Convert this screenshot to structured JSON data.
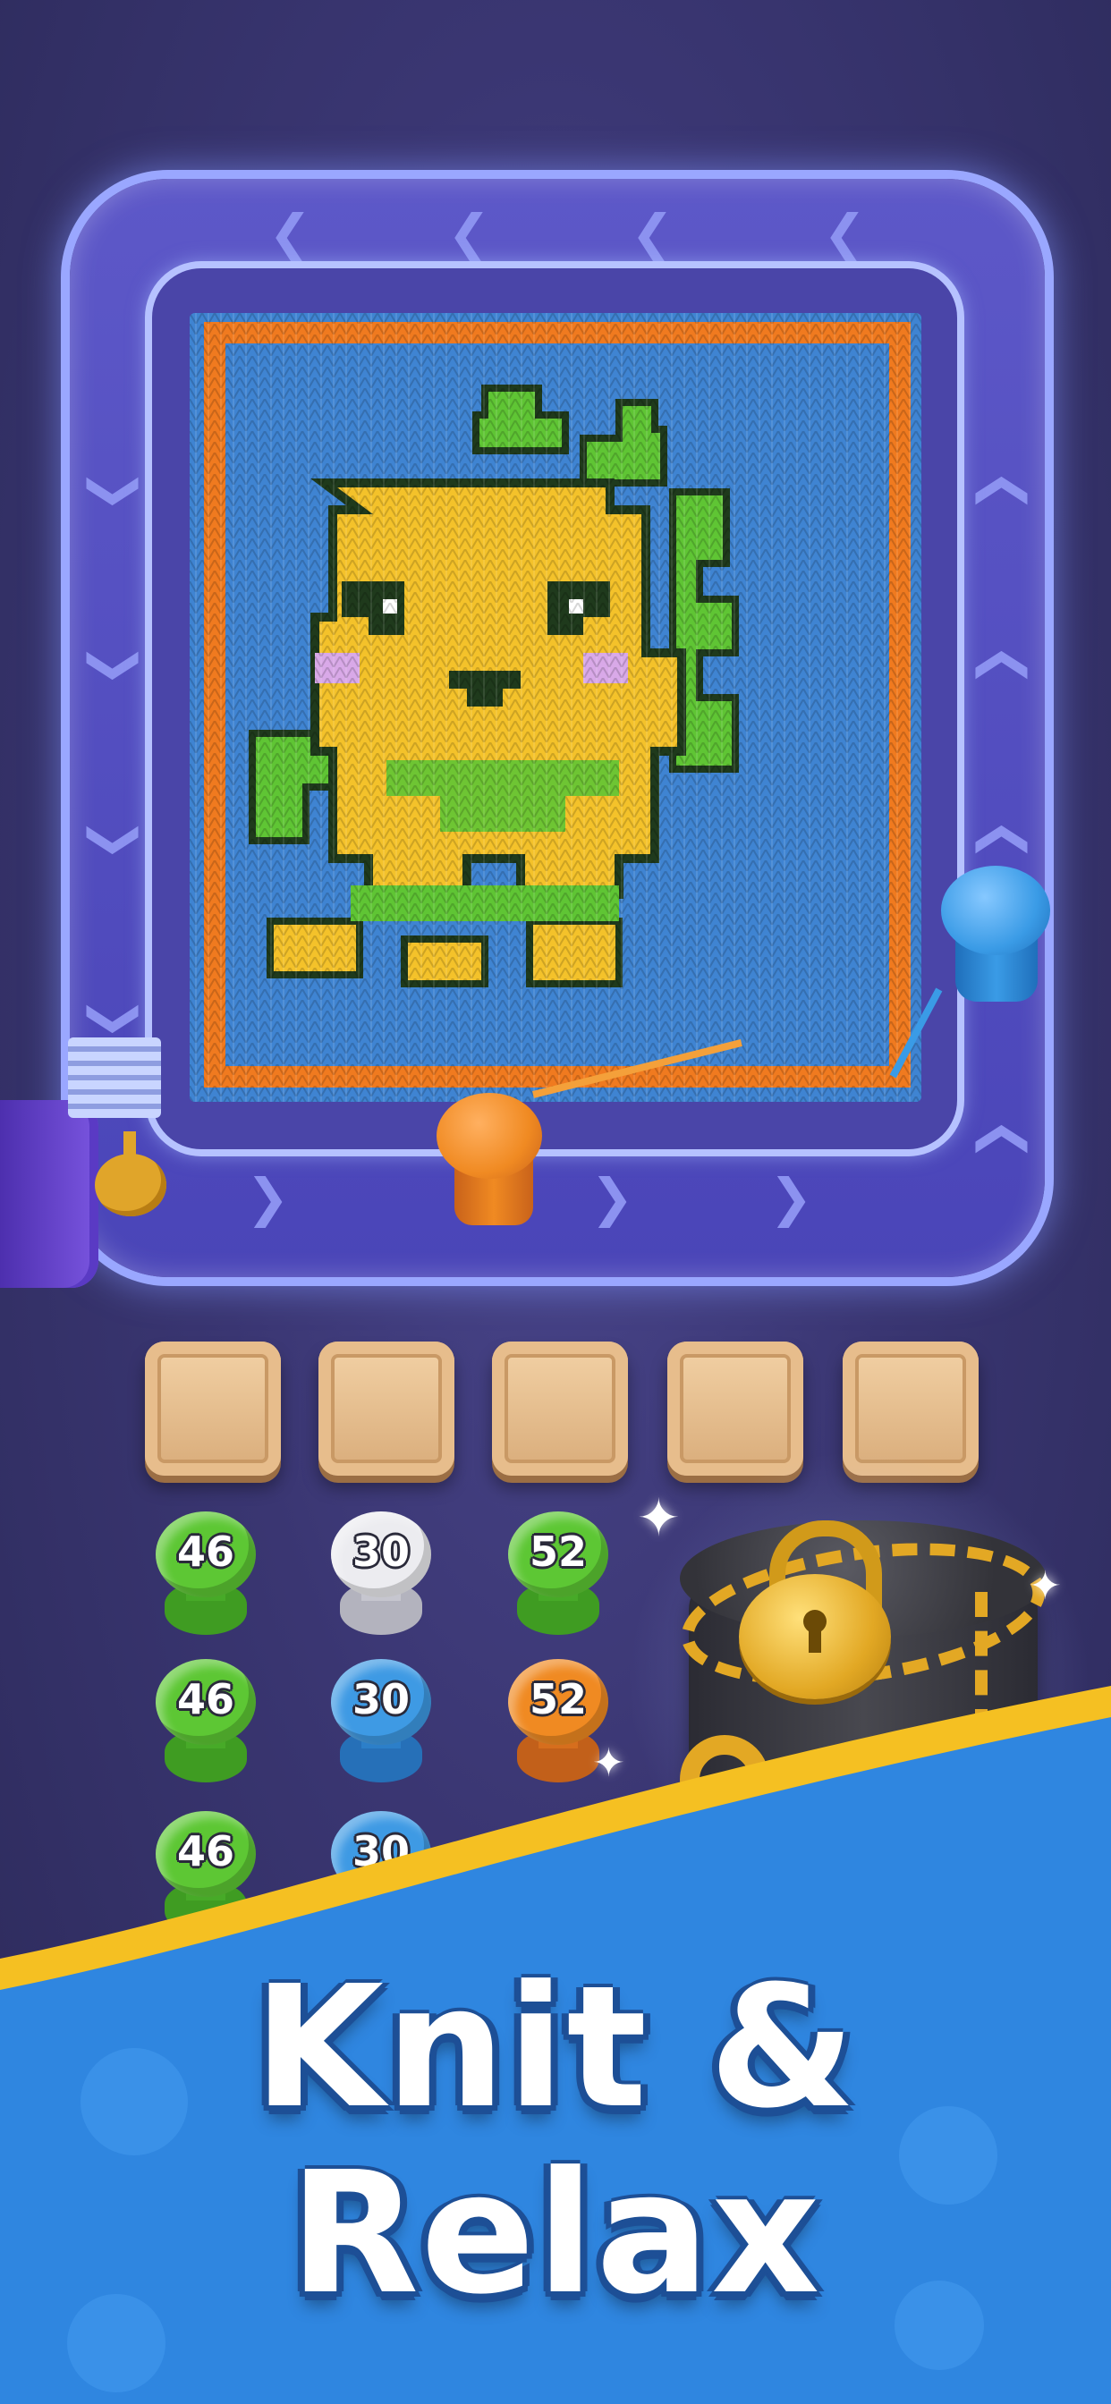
{
  "headline": {
    "line1": "Knit &",
    "line2": "Relax"
  },
  "colors": {
    "background": "#3a3672",
    "frame": "#4f4abd",
    "tapestry_border": "#f07a1f",
    "tapestry_bg": "#3f84d2",
    "body_yellow": "#f4c22a",
    "leaf_green": "#5fc534",
    "outline": "#1f3a1c",
    "blush": "#d9a9e8",
    "bottom_blue": "#2f86e0",
    "wave_yellow": "#f5c022"
  },
  "icons": [
    "chevron-left-icon",
    "chevron-right-icon",
    "chevron-down-icon",
    "chevron-up-icon",
    "padlock-icon",
    "key-icon",
    "chain-icon",
    "sparkle-icon",
    "yarn-ball-icon"
  ],
  "tray": {
    "slot_count": 5
  },
  "spool_grid": {
    "columns": [
      {
        "color": "#5dc734",
        "values": [
          "46",
          "46",
          "46"
        ]
      },
      {
        "color": "#e6e6ea",
        "values": [
          "30"
        ],
        "lower_color": "#3e9ae4",
        "lower_values": [
          "30",
          "30"
        ]
      },
      {
        "color": "#5dc734",
        "values": [
          "52"
        ],
        "lower_color": "#f08a22",
        "lower_values": [
          "52"
        ]
      }
    ]
  },
  "track_spools": [
    {
      "name": "orange-spool",
      "color": "#f08a22"
    },
    {
      "name": "blue-spool",
      "color": "#3a9be6"
    }
  ]
}
